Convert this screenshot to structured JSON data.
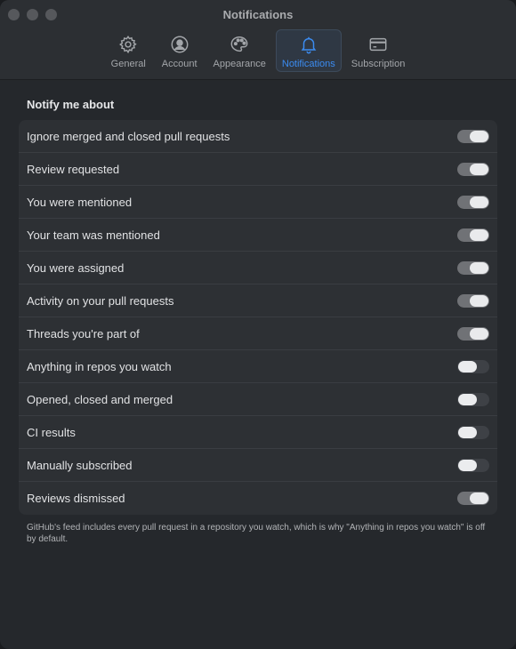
{
  "window": {
    "title": "Notifications"
  },
  "tabs": [
    {
      "label": "General",
      "icon": "gear-icon",
      "active": false
    },
    {
      "label": "Account",
      "icon": "person-circle-icon",
      "active": false
    },
    {
      "label": "Appearance",
      "icon": "palette-icon",
      "active": false
    },
    {
      "label": "Notifications",
      "icon": "bell-icon",
      "active": true
    },
    {
      "label": "Subscription",
      "icon": "credit-card-icon",
      "active": false
    }
  ],
  "section": {
    "title": "Notify me about"
  },
  "settings": [
    {
      "label": "Ignore merged and closed pull requests",
      "on": true
    },
    {
      "label": "Review requested",
      "on": true
    },
    {
      "label": "You were mentioned",
      "on": true
    },
    {
      "label": "Your team was mentioned",
      "on": true
    },
    {
      "label": "You were assigned",
      "on": true
    },
    {
      "label": "Activity on your pull requests",
      "on": true
    },
    {
      "label": "Threads you're part of",
      "on": true
    },
    {
      "label": "Anything in repos you watch",
      "on": false
    },
    {
      "label": "Opened, closed and merged",
      "on": false
    },
    {
      "label": "CI results",
      "on": false
    },
    {
      "label": "Manually subscribed",
      "on": false
    },
    {
      "label": "Reviews dismissed",
      "on": true
    }
  ],
  "footnote": "GitHub's feed includes every pull request in a repository you watch, which is why \"Anything in repos you watch\" is off by default.",
  "colors": {
    "accent": "#3b8cf2",
    "background": "#25282c",
    "panel": "#2d3034"
  }
}
